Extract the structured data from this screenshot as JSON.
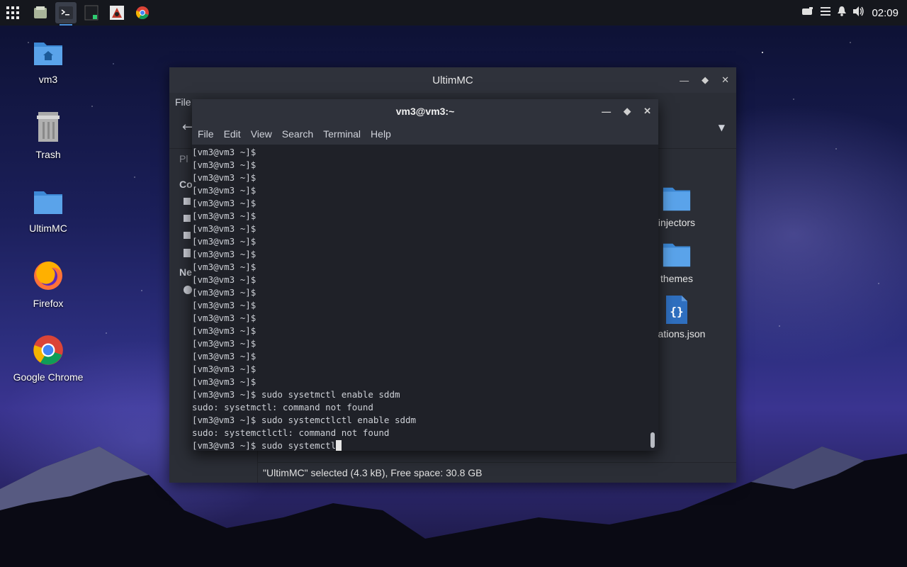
{
  "panel": {
    "tasks": [
      "file-manager-task",
      "terminal-task",
      "code-editor-task",
      "draw-app-task",
      "chrome-task"
    ],
    "clock": "02:09"
  },
  "desktop": {
    "icons": [
      {
        "label": "vm3"
      },
      {
        "label": "Trash"
      },
      {
        "label": "UltimMC"
      },
      {
        "label": "Firefox"
      },
      {
        "label": "Google Chrome"
      }
    ]
  },
  "file_manager": {
    "title": "UltimMC",
    "menu_first": "File",
    "sidebar_fragments": [
      "Pl",
      "Co",
      "Ne"
    ],
    "files": [
      {
        "label": "injectors",
        "type": "folder"
      },
      {
        "label": "themes",
        "type": "folder"
      },
      {
        "label": "fications.json",
        "type": "json"
      }
    ],
    "status": "\"UltimMC\" selected (4.3 kB), Free space: 30.8 GB"
  },
  "terminal": {
    "title": "vm3@vm3:~",
    "menu": [
      "File",
      "Edit",
      "View",
      "Search",
      "Terminal",
      "Help"
    ],
    "lines": [
      "[vm3@vm3 ~]$",
      "[vm3@vm3 ~]$",
      "[vm3@vm3 ~]$",
      "[vm3@vm3 ~]$",
      "[vm3@vm3 ~]$",
      "[vm3@vm3 ~]$",
      "[vm3@vm3 ~]$",
      "[vm3@vm3 ~]$",
      "[vm3@vm3 ~]$",
      "[vm3@vm3 ~]$",
      "[vm3@vm3 ~]$",
      "[vm3@vm3 ~]$",
      "[vm3@vm3 ~]$",
      "[vm3@vm3 ~]$",
      "[vm3@vm3 ~]$",
      "[vm3@vm3 ~]$",
      "[vm3@vm3 ~]$",
      "[vm3@vm3 ~]$",
      "[vm3@vm3 ~]$",
      "[vm3@vm3 ~]$ sudo sysetmctl enable sddm",
      "sudo: sysetmctl: command not found",
      "[vm3@vm3 ~]$ sudo systemctlctl enable sddm",
      "sudo: systemctlctl: command not found"
    ],
    "current_line": "[vm3@vm3 ~]$ sudo systemctl"
  }
}
